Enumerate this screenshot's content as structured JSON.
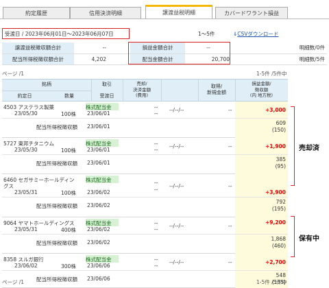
{
  "tabs": [
    {
      "label": "約定履歴",
      "active": false
    },
    {
      "label": "信用決済明細",
      "active": false
    },
    {
      "label": "譲渡益税明細",
      "active": true
    },
    {
      "label": "カバードワラント損益",
      "active": false
    }
  ],
  "filter": {
    "date_label": "受渡日 / 2023年06月01日〜2023年06月07日"
  },
  "rows_info": "1〜5件",
  "csv_label": "CSVダウンロード",
  "summary": {
    "tax_total_label": "譲渡益税徴収額合計",
    "tax_total_value": "--",
    "pnl_total_label": "損益金額合計",
    "pnl_total_value": "--",
    "detail_count_1": "明細数/0件",
    "div_tax_total_label": "配当所得税徴収額合計",
    "div_tax_total_value": "4,202",
    "div_total_label": "配当金額合計",
    "div_total_value": "20,700",
    "detail_count_2": "明細数/5件"
  },
  "pagination": {
    "page": "ページ /1",
    "range": "1-5件 /5件中"
  },
  "headers": {
    "stock": "銘柄",
    "trade_date": "約定日",
    "quantity": "数量",
    "trade_type": "取引",
    "settle_date": "受渡日",
    "sell_amount": "売却/\n決済金額\n(費用)",
    "acq_amount": "取得/\n新規年月日",
    "acq_price": "取得/\n新規金額",
    "pnl": "損益金額/\n徴収額\n(内 地方税)"
  },
  "rows": [
    {
      "stock": "4503 アステラス製薬",
      "trade_date": "23/05/30",
      "quantity": "100株",
      "type": "株式配当金",
      "settle": "23/06/01",
      "sell": "--",
      "sell_fee": "--",
      "acq_date": "--/--/--",
      "acq_price": "--",
      "pnl": "+3,000",
      "div_label": "配当所得税徴収額",
      "div_settle": "23/06/01",
      "tax": "609",
      "tax_local": "(150)"
    },
    {
      "stock": "5727 東邦チタニウム",
      "trade_date": "23/05/30",
      "quantity": "100株",
      "type": "株式配当金",
      "settle": "23/06/01",
      "sell": "--",
      "sell_fee": "--",
      "acq_date": "--/--/--",
      "acq_price": "--",
      "pnl": "+1,900",
      "div_label": "配当所得税徴収額",
      "div_settle": "23/06/01",
      "tax": "385",
      "tax_local": "(95)"
    },
    {
      "stock": "6460 セガサミーホールディン",
      "stock2": "グス",
      "trade_date": "23/05/31",
      "quantity": "100株",
      "type": "株式配当金",
      "settle": "23/06/02",
      "sell": "--",
      "sell_fee": "--",
      "acq_date": "--/--/--",
      "acq_price": "--",
      "pnl": "+3,900",
      "div_label": "配当所得税徴収額",
      "div_settle": "23/06/02",
      "tax": "792",
      "tax_local": "(195)"
    },
    {
      "stock": "9064 ヤマトホールディングス",
      "trade_date": "23/05/31",
      "quantity": "400株",
      "type": "株式配当金",
      "settle": "23/06/02",
      "sell": "--",
      "sell_fee": "--",
      "acq_date": "--/--/--",
      "acq_price": "--",
      "pnl": "+9,200",
      "div_label": "配当所得税徴収額",
      "div_settle": "23/06/02",
      "tax": "1,868",
      "tax_local": "(460)"
    },
    {
      "stock": "8358 スルガ銀行",
      "trade_date": "23/06/02",
      "quantity": "300株",
      "type": "株式配当金",
      "settle": "23/06/06",
      "sell": "--",
      "sell_fee": "--",
      "acq_date": "--/--/--",
      "acq_price": "--",
      "pnl": "+2,700",
      "div_label": "配当所得税徴収額",
      "div_settle": "23/06/06",
      "tax": "548",
      "tax_local": "(135)"
    }
  ],
  "annotations": {
    "sold": "売却済",
    "held": "保有中"
  },
  "colors": {
    "accent_red": "#e02020",
    "tab_active": "#f5b800",
    "header_blue": "#dfeef7",
    "green": "#d8f0d4",
    "yellow": "#fdfbdb"
  }
}
